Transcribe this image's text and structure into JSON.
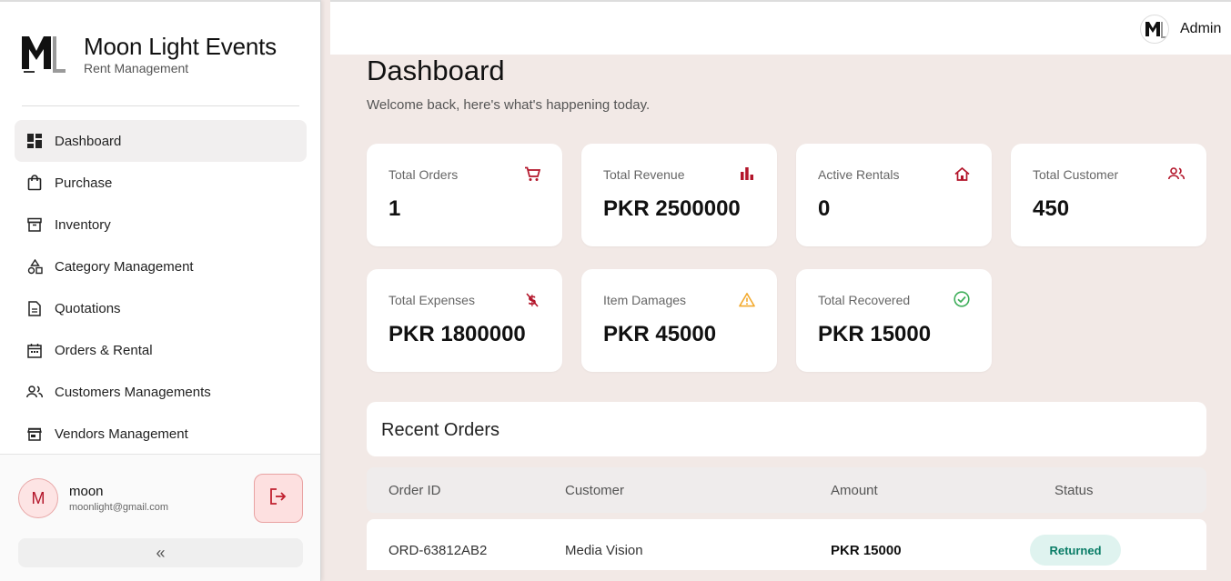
{
  "brand": {
    "title": "Moon Light Events",
    "subtitle": "Rent Management"
  },
  "sidebar": {
    "items": [
      {
        "label": "Dashboard",
        "icon": "dashboard-icon",
        "active": true
      },
      {
        "label": "Purchase",
        "icon": "shopping-bag-icon"
      },
      {
        "label": "Inventory",
        "icon": "archive-icon"
      },
      {
        "label": "Category Management",
        "icon": "category-icon"
      },
      {
        "label": "Quotations",
        "icon": "document-icon"
      },
      {
        "label": "Orders & Rental",
        "icon": "calendar-icon"
      },
      {
        "label": "Customers Managements",
        "icon": "people-icon"
      },
      {
        "label": "Vendors Management",
        "icon": "store-icon"
      }
    ],
    "collapse_glyph": "«"
  },
  "user": {
    "initial": "M",
    "name": "moon",
    "email": "moonlight@gmail.com"
  },
  "topbar": {
    "user_label": "Admin"
  },
  "page": {
    "title": "Dashboard",
    "subtitle": "Welcome back, here's what's happening today."
  },
  "stats": [
    {
      "label": "Total Orders",
      "value": "1",
      "icon": "cart-icon",
      "color": "#b3152a"
    },
    {
      "label": "Total Revenue",
      "value": "PKR 2500000",
      "icon": "bar-chart-icon",
      "color": "#b3152a"
    },
    {
      "label": "Active Rentals",
      "value": "0",
      "icon": "home-icon",
      "color": "#b3152a"
    },
    {
      "label": "Total Customer",
      "value": "450",
      "icon": "people-icon",
      "color": "#b3152a"
    },
    {
      "label": "Total Expenses",
      "value": "PKR 1800000",
      "icon": "money-off-icon",
      "color": "#b3152a"
    },
    {
      "label": "Item Damages",
      "value": "PKR 45000",
      "icon": "warning-icon",
      "color": "#f2a92d"
    },
    {
      "label": "Total Recovered",
      "value": "PKR 15000",
      "icon": "check-circle-icon",
      "color": "#3fae5a"
    }
  ],
  "recent_orders": {
    "title": "Recent Orders",
    "columns": [
      "Order ID",
      "Customer",
      "Amount",
      "Status"
    ],
    "rows": [
      {
        "order_id": "ORD-63812AB2",
        "customer": "Media Vision",
        "amount": "PKR 15000",
        "status": "Returned"
      }
    ]
  },
  "colors": {
    "accent": "#b3152a",
    "background": "#f2e9e6",
    "status_returned_bg": "#dff3ef",
    "status_returned_text": "#0a7d67"
  }
}
